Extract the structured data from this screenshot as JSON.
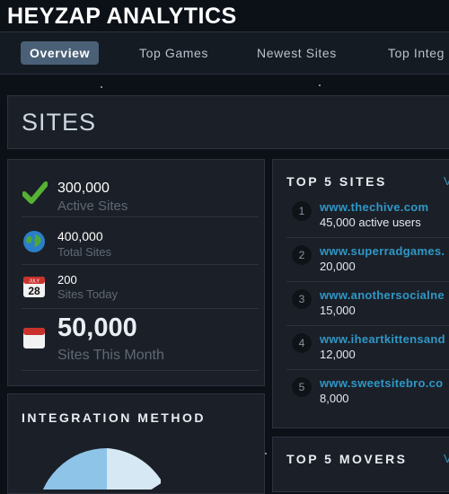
{
  "app_title": "HEYZAP ANALYTICS",
  "nav": {
    "tabs": [
      {
        "label": "Overview",
        "active": true
      },
      {
        "label": "Top Games",
        "active": false
      },
      {
        "label": "Newest Sites",
        "active": false
      },
      {
        "label": "Top Integ",
        "active": false
      }
    ]
  },
  "sites": {
    "title": "SITES"
  },
  "stats": [
    {
      "value": "300,000",
      "label": "Active Sites",
      "icon": "checkmark-icon"
    },
    {
      "value": "400,000",
      "label": "Total Sites",
      "icon": "globe-icon"
    },
    {
      "value": "200",
      "label": "Sites Today",
      "icon": "calendar-icon",
      "calendar_month": "JULY",
      "calendar_day": "28"
    },
    {
      "value": "50,000",
      "label": "Sites This Month",
      "icon": "calendar-blank-icon"
    }
  ],
  "top_sites": {
    "title": "TOP 5 SITES",
    "view_link": "V",
    "items": [
      {
        "rank": "1",
        "name": "www.thechive.com",
        "users": "45,000 active users"
      },
      {
        "rank": "2",
        "name": "www.superradgames.",
        "users": "20,000"
      },
      {
        "rank": "3",
        "name": "www.anothersocialne",
        "users": "15,000"
      },
      {
        "rank": "4",
        "name": "www.iheartkittensand",
        "users": "12,000"
      },
      {
        "rank": "5",
        "name": "www.sweetsitebro.co",
        "users": "8,000"
      }
    ]
  },
  "integration": {
    "title": "INTEGRATION METHOD"
  },
  "top_movers": {
    "title": "TOP 5 MOVERS",
    "view_link": "V"
  },
  "colors": {
    "background": "#0c1118",
    "card": "#1b2028",
    "accent_link": "#2f97c6",
    "active_tab": "#4a6076",
    "pie_primary": "#8dc4e8",
    "pie_secondary": "#d6e8f4"
  }
}
